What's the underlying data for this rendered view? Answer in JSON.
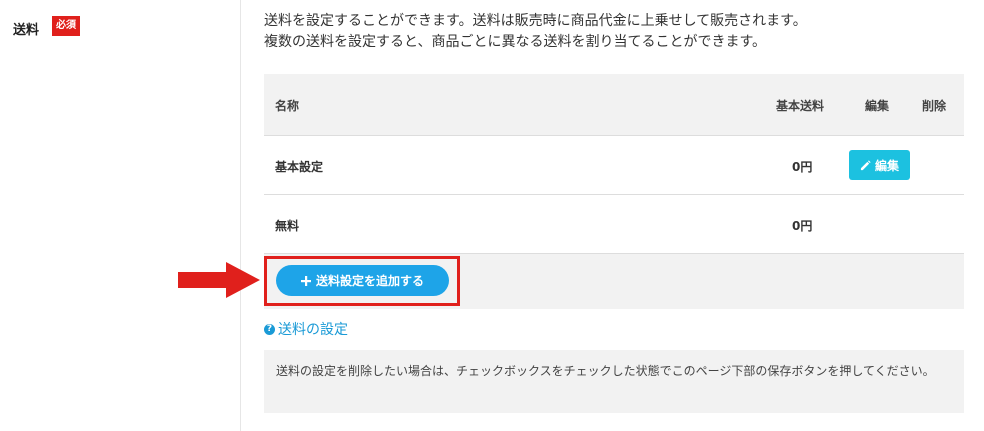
{
  "field": {
    "label": "送料",
    "required_badge": "必須"
  },
  "description": {
    "line1": "送料を設定することができます。送料は販売時に商品代金に上乗せして販売されます。",
    "line2": "複数の送料を設定すると、商品ごとに異なる送料を割り当てることができます。"
  },
  "table": {
    "headers": {
      "name": "名称",
      "base": "基本送料",
      "edit": "編集",
      "delete": "削除"
    },
    "rows": [
      {
        "name": "基本設定",
        "price": "0円",
        "edit_label": "編集"
      },
      {
        "name": "無料",
        "price": "0円"
      }
    ]
  },
  "add_button": {
    "label": "送料設定を追加する"
  },
  "help_link": {
    "label": "送料の設定"
  },
  "note": {
    "text": "送料の設定を削除したい場合は、チェックボックスをチェックした状態でこのページ下部の保存ボタンを押してください。"
  },
  "colors": {
    "required": "#e0201c",
    "edit_button": "#1cc1e0",
    "add_button": "#1ea4e8",
    "link": "#1a9ad6",
    "arrow": "#e0201c"
  },
  "icons": {
    "edit": "pencil-icon",
    "add": "plus-icon",
    "help": "question-circle-icon",
    "annotation": "arrow-right-icon"
  }
}
